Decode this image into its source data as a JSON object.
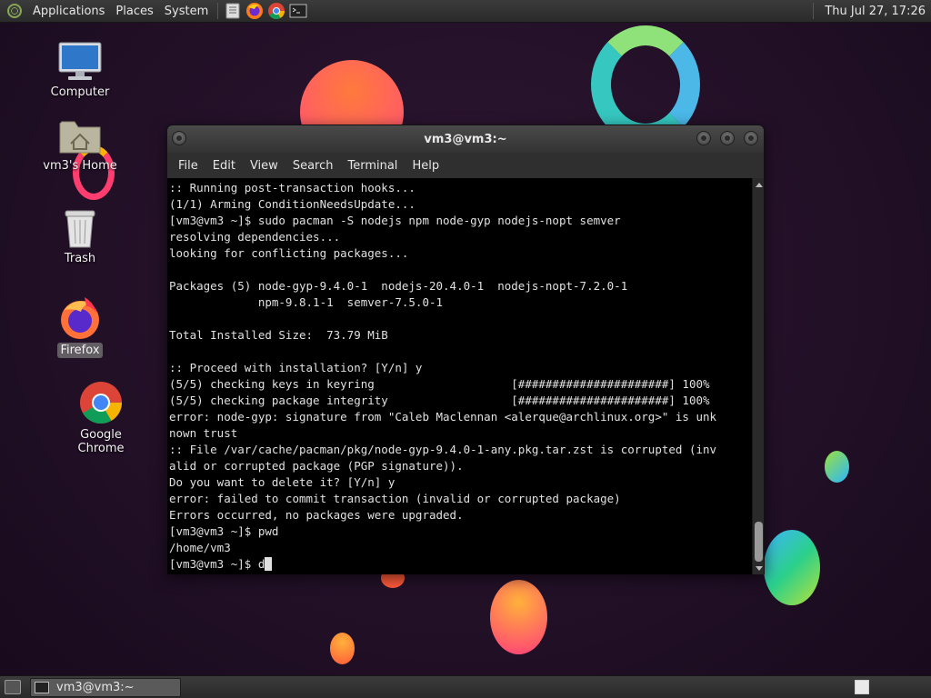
{
  "top_panel": {
    "menus": [
      "Applications",
      "Places",
      "System"
    ],
    "launchers": [
      "text-editor-icon",
      "firefox-icon",
      "chrome-icon",
      "terminal-icon"
    ],
    "clock": "Thu Jul 27, 17:26"
  },
  "desktop_icons": {
    "computer": "Computer",
    "home": "vm3's Home",
    "trash": "Trash",
    "firefox": "Firefox",
    "chrome": "Google Chrome"
  },
  "terminal": {
    "title": "vm3@vm3:~",
    "menu": [
      "File",
      "Edit",
      "View",
      "Search",
      "Terminal",
      "Help"
    ],
    "lines": [
      ":: Running post-transaction hooks...",
      "(1/1) Arming ConditionNeedsUpdate...",
      "[vm3@vm3 ~]$ sudo pacman -S nodejs npm node-gyp nodejs-nopt semver",
      "resolving dependencies...",
      "looking for conflicting packages...",
      "",
      "Packages (5) node-gyp-9.4.0-1  nodejs-20.4.0-1  nodejs-nopt-7.2.0-1",
      "             npm-9.8.1-1  semver-7.5.0-1",
      "",
      "Total Installed Size:  73.79 MiB",
      "",
      ":: Proceed with installation? [Y/n] y",
      "(5/5) checking keys in keyring                    [######################] 100%",
      "(5/5) checking package integrity                  [######################] 100%",
      "error: node-gyp: signature from \"Caleb Maclennan <alerque@archlinux.org>\" is unk",
      "nown trust",
      ":: File /var/cache/pacman/pkg/node-gyp-9.4.0-1-any.pkg.tar.zst is corrupted (inv",
      "alid or corrupted package (PGP signature)).",
      "Do you want to delete it? [Y/n] y",
      "error: failed to commit transaction (invalid or corrupted package)",
      "Errors occurred, no packages were upgraded.",
      "[vm3@vm3 ~]$ pwd",
      "/home/vm3"
    ],
    "prompt": "[vm3@vm3 ~]$ ",
    "current_input": "d"
  },
  "bottom_panel": {
    "task_title": "vm3@vm3:~"
  },
  "colors": {
    "desktop_bg": "#221027",
    "panel_bg": "#333333",
    "terminal_bg": "#000000",
    "terminal_fg": "#e0e0e0"
  }
}
